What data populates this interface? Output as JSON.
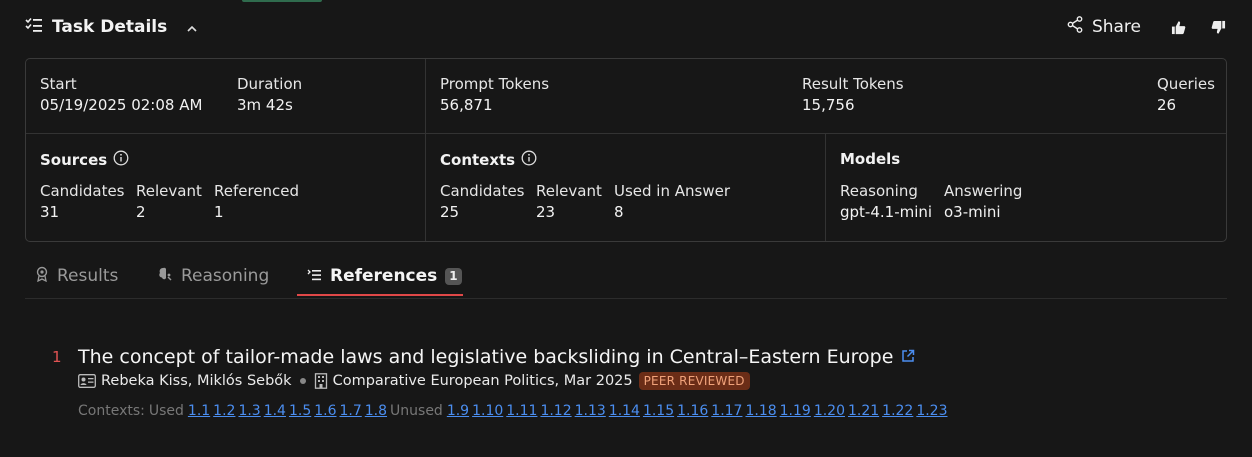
{
  "header": {
    "title": "Task Details",
    "share_label": "Share",
    "icons": [
      "list-check-icon",
      "chevron-up-icon",
      "share-icon",
      "thumbs-up-icon",
      "thumbs-down-icon"
    ]
  },
  "stats": {
    "start_label": "Start",
    "start_value": "05/19/2025 02:08 AM",
    "duration_label": "Duration",
    "duration_value": "3m 42s",
    "prompt_tokens_label": "Prompt Tokens",
    "prompt_tokens_value": "56,871",
    "result_tokens_label": "Result Tokens",
    "result_tokens_value": "15,756",
    "queries_label": "Queries",
    "queries_value": "26"
  },
  "sources": {
    "title": "Sources",
    "candidates_label": "Candidates",
    "candidates_value": "31",
    "relevant_label": "Relevant",
    "relevant_value": "2",
    "referenced_label": "Referenced",
    "referenced_value": "1"
  },
  "contexts": {
    "title": "Contexts",
    "candidates_label": "Candidates",
    "candidates_value": "25",
    "relevant_label": "Relevant",
    "relevant_value": "23",
    "used_label": "Used in Answer",
    "used_value": "8"
  },
  "models": {
    "title": "Models",
    "reasoning_label": "Reasoning",
    "reasoning_value": "gpt-4.1-mini",
    "answering_label": "Answering",
    "answering_value": "o3-mini"
  },
  "tabs": {
    "results": "Results",
    "reasoning": "Reasoning",
    "references": "References",
    "references_count": "1"
  },
  "reference": {
    "number": "1",
    "title": "The concept of tailor-made laws and legislative backsliding in Central–Eastern Europe",
    "authors": "Rebeka Kiss, Miklós Sebők",
    "venue": "Comparative European Politics, Mar 2025",
    "badge": "PEER REVIEWED",
    "contexts_label": "Contexts:",
    "used_label": "Used",
    "unused_label": "Unused",
    "used": [
      "1.1",
      "1.2",
      "1.3",
      "1.4",
      "1.5",
      "1.6",
      "1.7",
      "1.8"
    ],
    "unused": [
      "1.9",
      "1.10",
      "1.11",
      "1.12",
      "1.13",
      "1.14",
      "1.15",
      "1.16",
      "1.17",
      "1.18",
      "1.19",
      "1.20",
      "1.21",
      "1.22",
      "1.23"
    ]
  },
  "colors": {
    "accent_red": "#e05353",
    "link_blue": "#4b8ef0",
    "badge_bg": "#6b2d17",
    "badge_text": "#f0a27a"
  }
}
